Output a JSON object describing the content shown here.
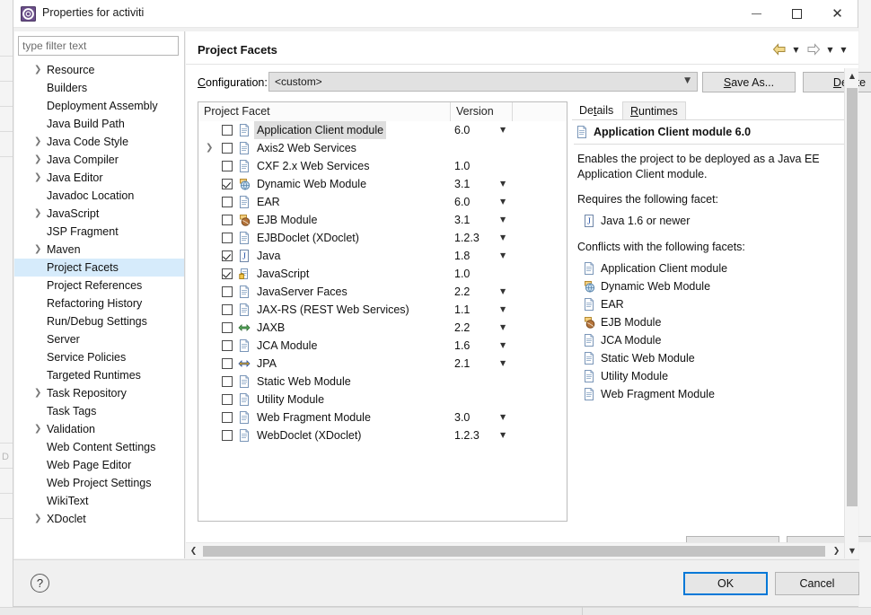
{
  "window": {
    "title": "Properties for activiti",
    "app_icon": "properties-gear-icon",
    "minimize_label": "Minimize",
    "maximize_label": "Maximize",
    "close_label": "Close"
  },
  "sidebar": {
    "filter_placeholder": "type filter text",
    "filter_value": "",
    "items": [
      {
        "label": "Resource",
        "expandable": true,
        "selected": false
      },
      {
        "label": "Builders",
        "expandable": false,
        "selected": false
      },
      {
        "label": "Deployment Assembly",
        "expandable": false,
        "selected": false
      },
      {
        "label": "Java Build Path",
        "expandable": false,
        "selected": false
      },
      {
        "label": "Java Code Style",
        "expandable": true,
        "selected": false
      },
      {
        "label": "Java Compiler",
        "expandable": true,
        "selected": false
      },
      {
        "label": "Java Editor",
        "expandable": true,
        "selected": false
      },
      {
        "label": "Javadoc Location",
        "expandable": false,
        "selected": false
      },
      {
        "label": "JavaScript",
        "expandable": true,
        "selected": false
      },
      {
        "label": "JSP Fragment",
        "expandable": false,
        "selected": false
      },
      {
        "label": "Maven",
        "expandable": true,
        "selected": false
      },
      {
        "label": "Project Facets",
        "expandable": false,
        "selected": true
      },
      {
        "label": "Project References",
        "expandable": false,
        "selected": false
      },
      {
        "label": "Refactoring History",
        "expandable": false,
        "selected": false
      },
      {
        "label": "Run/Debug Settings",
        "expandable": false,
        "selected": false
      },
      {
        "label": "Server",
        "expandable": false,
        "selected": false
      },
      {
        "label": "Service Policies",
        "expandable": false,
        "selected": false
      },
      {
        "label": "Targeted Runtimes",
        "expandable": false,
        "selected": false
      },
      {
        "label": "Task Repository",
        "expandable": true,
        "selected": false
      },
      {
        "label": "Task Tags",
        "expandable": false,
        "selected": false
      },
      {
        "label": "Validation",
        "expandable": true,
        "selected": false
      },
      {
        "label": "Web Content Settings",
        "expandable": false,
        "selected": false
      },
      {
        "label": "Web Page Editor",
        "expandable": false,
        "selected": false
      },
      {
        "label": "Web Project Settings",
        "expandable": false,
        "selected": false
      },
      {
        "label": "WikiText",
        "expandable": false,
        "selected": false
      },
      {
        "label": "XDoclet",
        "expandable": true,
        "selected": false
      }
    ]
  },
  "page": {
    "title": "Project Facets",
    "back_icon": "back-arrow-icon",
    "forward_icon": "forward-arrow-icon",
    "menu_icon": "chevron-down-icon"
  },
  "configuration": {
    "label": "Configuration:",
    "label_mnemonic": "C",
    "value": "<custom>",
    "save_as_label": "Save As...",
    "save_as_mnemonic": "S",
    "delete_label": "Delete",
    "delete_mnemonic": "D"
  },
  "facet_table": {
    "columns": [
      "Project Facet",
      "Version",
      ""
    ],
    "rows": [
      {
        "name": "Application Client module",
        "version": "6.0",
        "checked": false,
        "expandable": false,
        "has_dropdown": true,
        "icon": "doc-icon",
        "selected": true
      },
      {
        "name": "Axis2 Web Services",
        "version": "",
        "checked": false,
        "expandable": true,
        "has_dropdown": false,
        "icon": "doc-icon",
        "selected": false
      },
      {
        "name": "CXF 2.x Web Services",
        "version": "1.0",
        "checked": false,
        "expandable": false,
        "has_dropdown": false,
        "icon": "doc-icon",
        "selected": false
      },
      {
        "name": "Dynamic Web Module",
        "version": "3.1",
        "checked": true,
        "expandable": false,
        "has_dropdown": true,
        "icon": "web-module-icon",
        "selected": false
      },
      {
        "name": "EAR",
        "version": "6.0",
        "checked": false,
        "expandable": false,
        "has_dropdown": true,
        "icon": "doc-icon",
        "selected": false
      },
      {
        "name": "EJB Module",
        "version": "3.1",
        "checked": false,
        "expandable": false,
        "has_dropdown": true,
        "icon": "ejb-module-icon",
        "selected": false
      },
      {
        "name": "EJBDoclet (XDoclet)",
        "version": "1.2.3",
        "checked": false,
        "expandable": false,
        "has_dropdown": true,
        "icon": "doc-icon",
        "selected": false
      },
      {
        "name": "Java",
        "version": "1.8",
        "checked": true,
        "expandable": false,
        "has_dropdown": true,
        "icon": "java-icon",
        "selected": false
      },
      {
        "name": "JavaScript",
        "version": "1.0",
        "checked": true,
        "expandable": false,
        "has_dropdown": false,
        "icon": "javascript-icon",
        "selected": false
      },
      {
        "name": "JavaServer Faces",
        "version": "2.2",
        "checked": false,
        "expandable": false,
        "has_dropdown": true,
        "icon": "doc-icon",
        "selected": false
      },
      {
        "name": "JAX-RS (REST Web Services)",
        "version": "1.1",
        "checked": false,
        "expandable": false,
        "has_dropdown": true,
        "icon": "doc-icon",
        "selected": false
      },
      {
        "name": "JAXB",
        "version": "2.2",
        "checked": false,
        "expandable": false,
        "has_dropdown": true,
        "icon": "jaxb-icon",
        "selected": false
      },
      {
        "name": "JCA Module",
        "version": "1.6",
        "checked": false,
        "expandable": false,
        "has_dropdown": true,
        "icon": "doc-icon",
        "selected": false
      },
      {
        "name": "JPA",
        "version": "2.1",
        "checked": false,
        "expandable": false,
        "has_dropdown": true,
        "icon": "jpa-icon",
        "selected": false
      },
      {
        "name": "Static Web Module",
        "version": "",
        "checked": false,
        "expandable": false,
        "has_dropdown": false,
        "icon": "doc-icon",
        "selected": false
      },
      {
        "name": "Utility Module",
        "version": "",
        "checked": false,
        "expandable": false,
        "has_dropdown": false,
        "icon": "doc-icon",
        "selected": false
      },
      {
        "name": "Web Fragment Module",
        "version": "3.0",
        "checked": false,
        "expandable": false,
        "has_dropdown": true,
        "icon": "doc-icon",
        "selected": false
      },
      {
        "name": "WebDoclet (XDoclet)",
        "version": "1.2.3",
        "checked": false,
        "expandable": false,
        "has_dropdown": true,
        "icon": "doc-icon",
        "selected": false
      }
    ]
  },
  "details": {
    "tabs": [
      {
        "label": "Details",
        "mnemonic": "t",
        "active": true
      },
      {
        "label": "Runtimes",
        "mnemonic": "R",
        "active": false
      }
    ],
    "heading": "Application Client module 6.0",
    "heading_icon": "doc-icon",
    "description": "Enables the project to be deployed as a Java EE Application Client module.",
    "requires_label": "Requires the following facet:",
    "requires": [
      {
        "label": "Java 1.6 or newer",
        "icon": "java-icon"
      }
    ],
    "conflicts_label": "Conflicts with the following facets:",
    "conflicts": [
      {
        "label": "Application Client module",
        "icon": "doc-icon"
      },
      {
        "label": "Dynamic Web Module",
        "icon": "web-module-icon"
      },
      {
        "label": "EAR",
        "icon": "doc-icon"
      },
      {
        "label": "EJB Module",
        "icon": "ejb-module-icon"
      },
      {
        "label": "JCA Module",
        "icon": "doc-icon"
      },
      {
        "label": "Static Web Module",
        "icon": "doc-icon"
      },
      {
        "label": "Utility Module",
        "icon": "doc-icon"
      },
      {
        "label": "Web Fragment Module",
        "icon": "doc-icon"
      }
    ]
  },
  "scrollbars": {
    "vertical_up_icon": "chevron-up-icon",
    "vertical_down_icon": "chevron-down-icon",
    "horizontal_left_icon": "chevron-left-icon",
    "horizontal_right_icon": "chevron-right-icon"
  },
  "footer": {
    "help_icon": "help-question-icon",
    "ok_label": "OK",
    "cancel_label": "Cancel"
  },
  "backdrop": {
    "letter": "D"
  },
  "colors": {
    "selection_blue": "#d6ebfb",
    "focus_blue": "#0078d7",
    "row_selected_gray": "#dedede",
    "back_arrow_gold": "#f2d98b",
    "dialog_bg": "#f0f0f0"
  }
}
